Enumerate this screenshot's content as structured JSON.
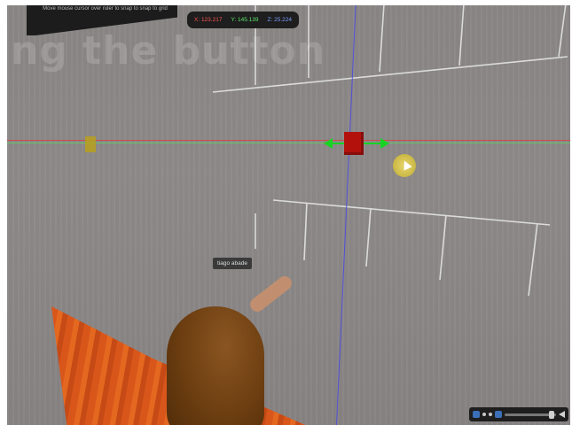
{
  "window": {
    "hint_text": "Move mouse cursor over ruler to snap to snap to grid",
    "watermark_text": "ng the button"
  },
  "coordinates": {
    "x_label": "X: 123.217",
    "y_label": "Y: 145.139",
    "z_label": "Z: 25.224"
  },
  "avatar": {
    "name": "tiago abade"
  },
  "colors": {
    "x_axis": "#ff5252",
    "y_axis": "#5ce66a",
    "z_axis": "#7b9dff",
    "selected_prim": "#b3120c",
    "drag_handles": "#18d323"
  },
  "toolbar": {
    "icons": [
      "media-icon",
      "play-icon",
      "stop-icon",
      "volume-icon"
    ]
  }
}
